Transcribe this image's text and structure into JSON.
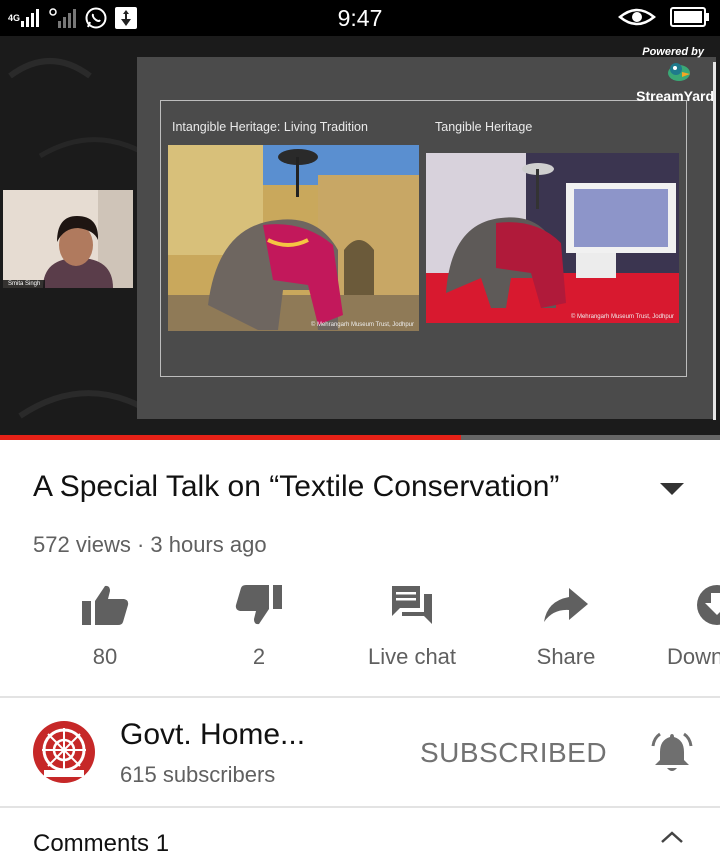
{
  "status_bar": {
    "network_label": "4G",
    "time": "9:47"
  },
  "video": {
    "webcam_name": "Smita Singh",
    "powered_by": "Powered by",
    "streamyard": "StreamYard",
    "slide": {
      "left_caption": "Intangible Heritage: Living Tradition",
      "right_caption": "Tangible Heritage",
      "left_credit": "© Mehrangarh Museum Trust, Jodhpur",
      "right_credit": "© Mehrangarh Museum Trust, Jodhpur"
    },
    "progress": 0.64,
    "progress_color": "#e62117"
  },
  "info": {
    "title": "A Special Talk on  “Textile Conservation”",
    "meta": "572 views · 3 hours ago"
  },
  "actions": [
    {
      "label": "80",
      "icon": "like-icon"
    },
    {
      "label": "2",
      "icon": "dislike-icon"
    },
    {
      "label": "Live chat",
      "icon": "live-chat-icon"
    },
    {
      "label": "Share",
      "icon": "share-icon"
    },
    {
      "label": "Down",
      "icon": "download-icon"
    }
  ],
  "channel": {
    "name": "Govt. Home...",
    "subscribers": "615 subscribers",
    "subscribed_label": "SUBSCRIBED",
    "accent": "#c62828"
  },
  "comments": {
    "label": "Comments  1"
  }
}
